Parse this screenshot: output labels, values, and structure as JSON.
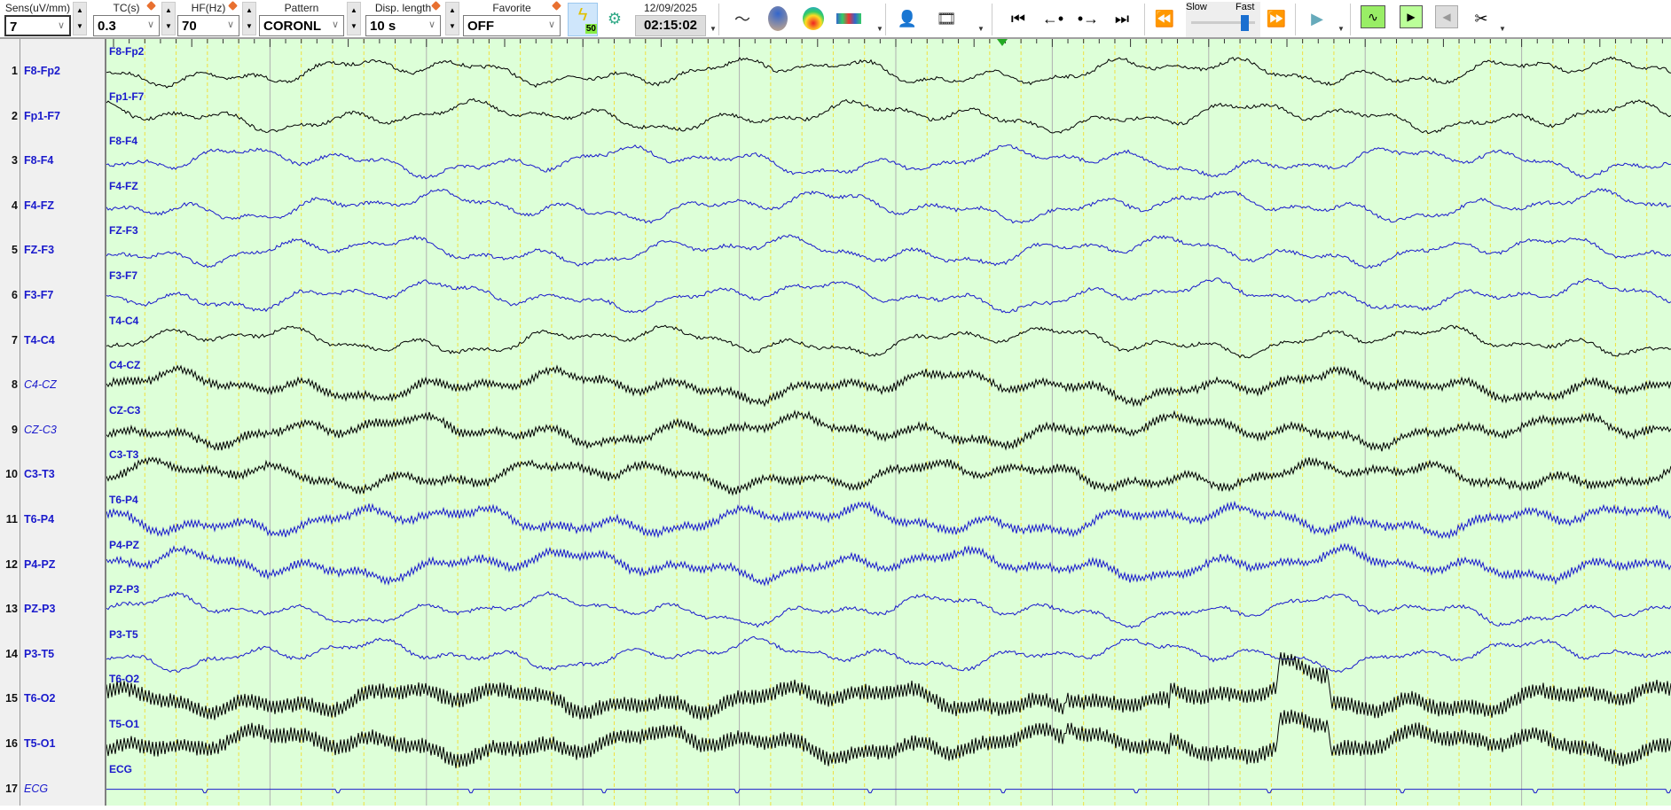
{
  "toolbar": {
    "sens": {
      "label": "Sens(uV/mm)",
      "value": "7"
    },
    "tc": {
      "label": "TC(s)",
      "value": "0.3"
    },
    "hf": {
      "label": "HF(Hz)",
      "value": "70"
    },
    "pattern": {
      "label": "Pattern",
      "value": "CORONL"
    },
    "disp_length": {
      "label": "Disp. length",
      "value": "10 s"
    },
    "favorite": {
      "label": "Favorite",
      "value": "OFF"
    },
    "notch_badge": "50",
    "date": "12/09/2025",
    "time": "02:15:02",
    "speed_slow": "Slow",
    "speed_fast": "Fast",
    "speed_level": 0.85
  },
  "channels": [
    {
      "num": "1",
      "name": "F8-Fp2",
      "color": "#000000",
      "italic": false
    },
    {
      "num": "2",
      "name": "Fp1-F7",
      "color": "#000000",
      "italic": false
    },
    {
      "num": "3",
      "name": "F8-F4",
      "color": "#1a1acc",
      "italic": false
    },
    {
      "num": "4",
      "name": "F4-FZ",
      "color": "#1a1acc",
      "italic": false
    },
    {
      "num": "5",
      "name": "FZ-F3",
      "color": "#1a1acc",
      "italic": false
    },
    {
      "num": "6",
      "name": "F3-F7",
      "color": "#1a1acc",
      "italic": false
    },
    {
      "num": "7",
      "name": "T4-C4",
      "color": "#000000",
      "italic": false
    },
    {
      "num": "8",
      "name": "C4-CZ",
      "color": "#000000",
      "italic": true
    },
    {
      "num": "9",
      "name": "CZ-C3",
      "color": "#000000",
      "italic": true
    },
    {
      "num": "10",
      "name": "C3-T3",
      "color": "#000000",
      "italic": false
    },
    {
      "num": "11",
      "name": "T6-P4",
      "color": "#1a1acc",
      "italic": false
    },
    {
      "num": "12",
      "name": "P4-PZ",
      "color": "#1a1acc",
      "italic": false
    },
    {
      "num": "13",
      "name": "PZ-P3",
      "color": "#1a1acc",
      "italic": false
    },
    {
      "num": "14",
      "name": "P3-T5",
      "color": "#1a1acc",
      "italic": false
    },
    {
      "num": "15",
      "name": "T6-O2",
      "color": "#000000",
      "italic": false
    },
    {
      "num": "16",
      "name": "T5-O1",
      "color": "#000000",
      "italic": false
    },
    {
      "num": "17",
      "name": "ECG",
      "color": "#1a1acc",
      "italic": true
    }
  ]
}
